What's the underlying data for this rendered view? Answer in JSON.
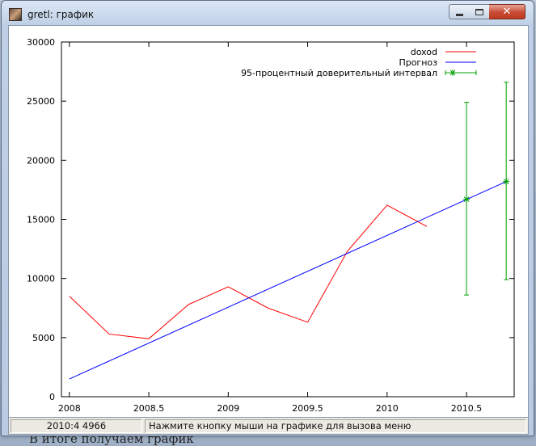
{
  "window": {
    "title": "gretl: график",
    "icon": "gretl-app-icon"
  },
  "controls": {
    "minimize_icon": "minimize-icon",
    "maximize_icon": "maximize-icon",
    "close_label": "✕"
  },
  "background_caption": "В итоге получаем график",
  "statusbar": {
    "coords": "2010:4 4966",
    "hint": "Нажмите кнопку мыши на графике для вызова меню"
  },
  "chart_data": {
    "type": "line",
    "xlim": [
      2007.95,
      2010.8
    ],
    "ylim": [
      0,
      30000
    ],
    "x_ticks": [
      "2008",
      "2008.5",
      "2009",
      "2009.5",
      "2010",
      "2010.5"
    ],
    "x_tick_values": [
      2008,
      2008.5,
      2009,
      2009.5,
      2010,
      2010.5
    ],
    "y_ticks": [
      "0",
      "5000",
      "10000",
      "15000",
      "20000",
      "25000",
      "30000"
    ],
    "y_tick_values": [
      0,
      5000,
      10000,
      15000,
      20000,
      25000,
      30000
    ],
    "legend_position": "top-right",
    "series": [
      {
        "name": "doxod",
        "color": "#ff0000",
        "x": [
          2008,
          2008.25,
          2008.5,
          2008.75,
          2009,
          2009.25,
          2009.5,
          2009.75,
          2010,
          2010.25
        ],
        "y": [
          8500,
          5300,
          4900,
          7800,
          9300,
          7500,
          6300,
          12300,
          16200,
          14400
        ]
      },
      {
        "name": "Прогноз",
        "color": "#0000ff",
        "x": [
          2008,
          2010.75
        ],
        "y": [
          1500,
          18200
        ]
      }
    ],
    "interval": {
      "name": "95-процентный доверительный интервал",
      "color": "#00a000",
      "x": [
        2010.5,
        2010.75
      ],
      "center": [
        16700,
        18200
      ],
      "low": [
        8600,
        9900
      ],
      "high": [
        24900,
        26600
      ]
    }
  }
}
